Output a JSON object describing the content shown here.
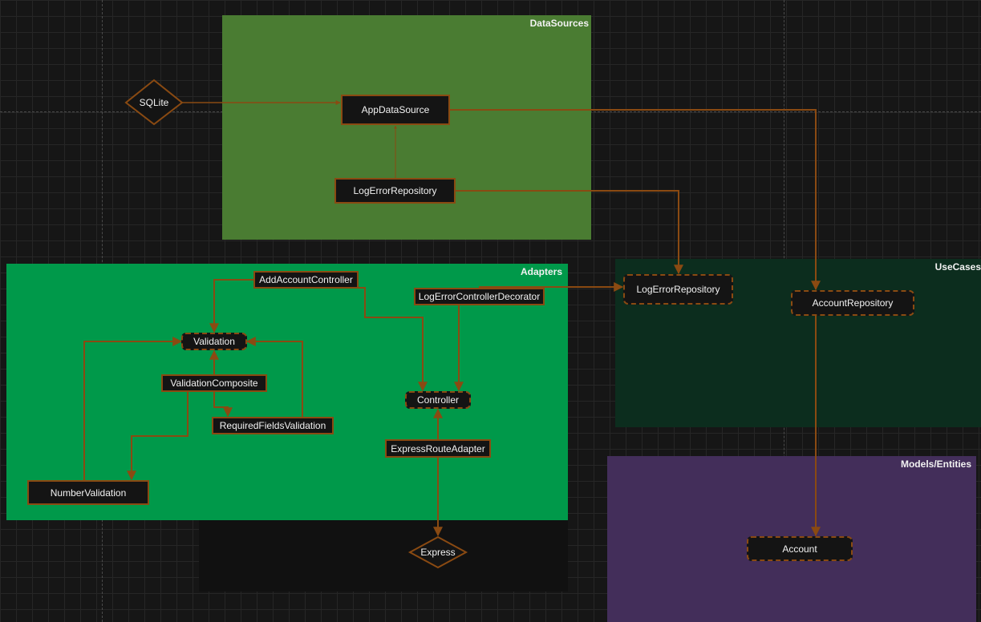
{
  "groups": {
    "datasources": "DataSources",
    "adapters": "Adapters",
    "usecases": "UseCases",
    "models": "Models/Entities"
  },
  "nodes": {
    "sqlite": "SQLite",
    "app_data_source": "AppDataSource",
    "log_error_repository_ds": "LogErrorRepository",
    "add_account_controller": "AddAccountController",
    "log_error_controller_decorator": "LogErrorControllerDecorator",
    "validation": "Validation",
    "validation_composite": "ValidationComposite",
    "required_fields_validation": "RequiredFieldsValidation",
    "number_validation": "NumberValidation",
    "controller": "Controller",
    "express_route_adapter": "ExpressRouteAdapter",
    "express": "Express",
    "log_error_repository_uc": "LogErrorRepository",
    "account_repository": "AccountRepository",
    "account": "Account"
  },
  "colors": {
    "datasources": "#4a7c32",
    "adapters": "#00994a",
    "usecases": "#0c2d1e",
    "models": "#432e5a",
    "edge": "#8a4a12"
  }
}
